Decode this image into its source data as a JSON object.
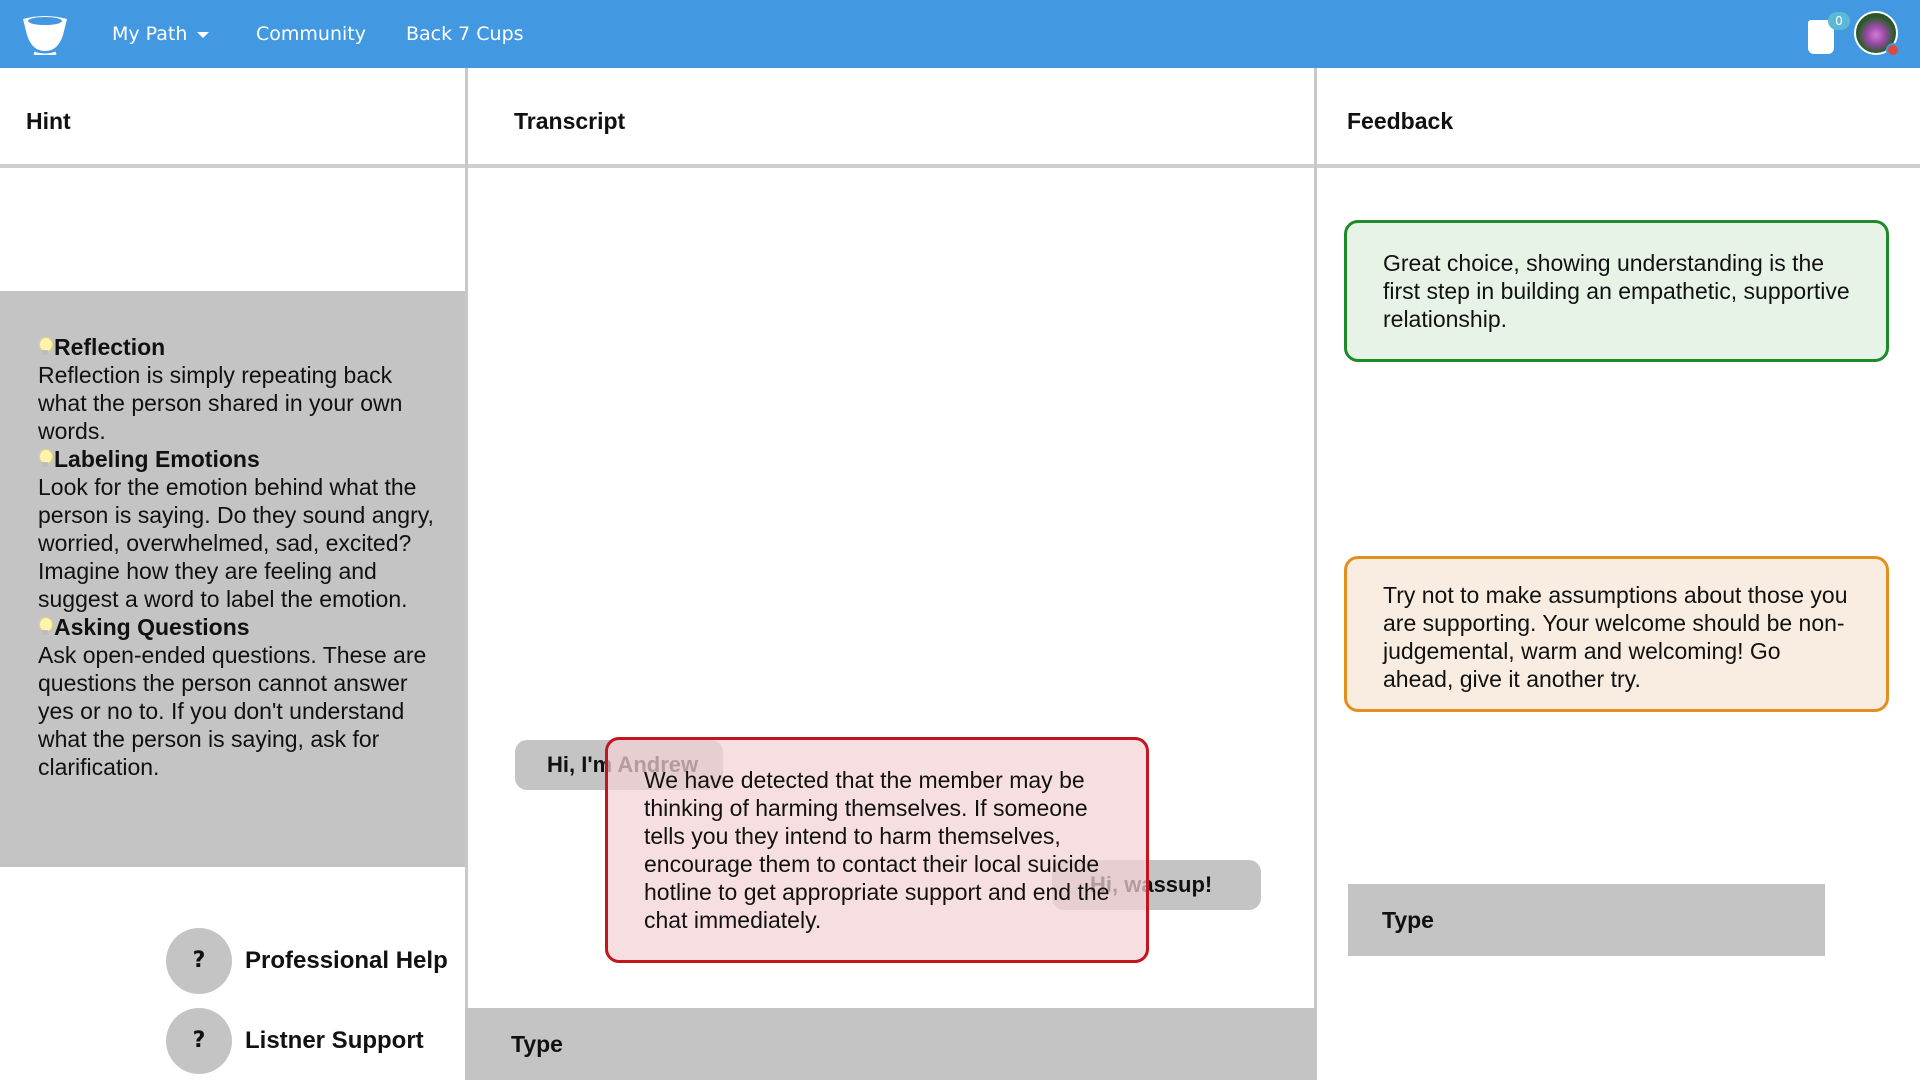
{
  "nav": {
    "my_path": "My Path",
    "community": "Community",
    "back_cups": "Back 7 Cups",
    "cup_count": "0",
    "brand_color": "#4299e1"
  },
  "hint": {
    "title": "Hint",
    "sections": [
      {
        "heading": "Reflection",
        "text": "Reflection is simply repeating back what the person shared in your own words."
      },
      {
        "heading": "Labeling Emotions",
        "text": "Look for the emotion behind what the person is saying. Do they sound angry, worried, overwhelmed, sad, excited? Imagine how they are feeling and suggest a word to label the emotion."
      },
      {
        "heading": "Asking Questions",
        "text": "Ask open-ended questions. These are questions the person cannot answer yes or no to. If you don't understand what the person is saying, ask for clarification."
      }
    ],
    "help_buttons": [
      {
        "icon": "?",
        "label": "Professional Help"
      },
      {
        "icon": "?",
        "label": "Listner Support"
      }
    ]
  },
  "transcript": {
    "title": "Transcript",
    "messages": [
      {
        "side": "left",
        "text": "Hi, I'm Andrew"
      },
      {
        "side": "right",
        "text": "Hi, wassup!"
      }
    ],
    "alert": "We have detected that the member may be thinking of harming themselves. If someone tells you they intend to harm themselves, encourage them to contact their local suicide hotline to get appropriate support and end the chat immediately.",
    "input_placeholder": "Type"
  },
  "feedback": {
    "title": "Feedback",
    "positive": "Great choice, showing understanding is the first step in building an empathetic, supportive relationship.",
    "warning": "Try not to make assumptions about those you are supporting. Your welcome should be non-judgemental, warm and welcoming! Go ahead, give it another try.",
    "input_placeholder": "Type",
    "colors": {
      "positive_border": "#1f8a2a",
      "warning_border": "#e38f1e",
      "alert_border": "#c2151d"
    }
  }
}
